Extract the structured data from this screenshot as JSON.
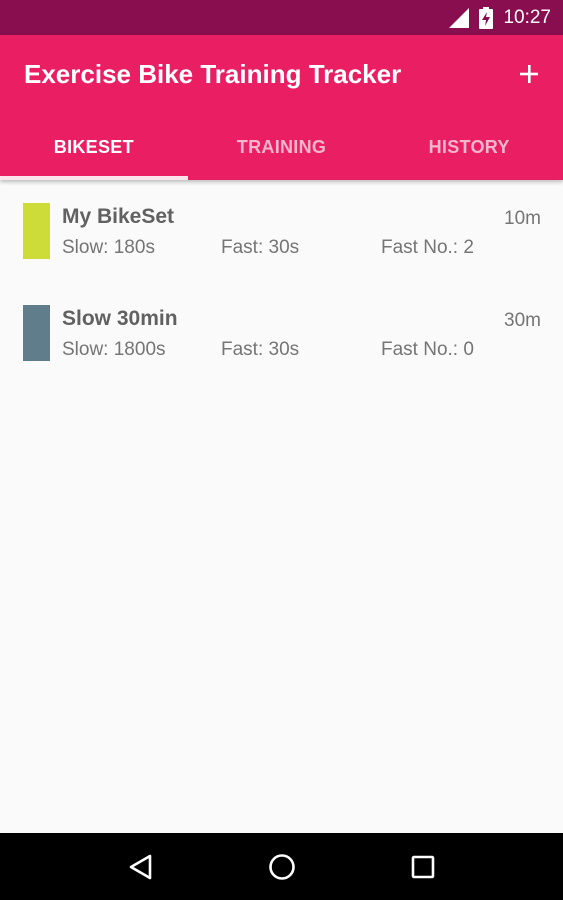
{
  "status_bar": {
    "time": "10:27",
    "icons": [
      "signal-icon",
      "battery-charging-icon"
    ]
  },
  "app_bar": {
    "title": "Exercise Bike Training Tracker",
    "action_icon": "plus-icon",
    "tabs": [
      {
        "label": "BIKESET",
        "active": true
      },
      {
        "label": "TRAINING",
        "active": false
      },
      {
        "label": "HISTORY",
        "active": false
      }
    ]
  },
  "bikesets": [
    {
      "name": "My BikeSet",
      "duration": "10m",
      "slow": "Slow: 180s",
      "fast": "Fast: 30s",
      "fast_no": "Fast No.: 2",
      "color": "#cddc39"
    },
    {
      "name": "Slow 30min",
      "duration": "30m",
      "slow": "Slow: 1800s",
      "fast": "Fast: 30s",
      "fast_no": "Fast No.: 0",
      "color": "#607d8b"
    }
  ],
  "nav_bar": {
    "icons": [
      "back-icon",
      "home-icon",
      "recents-icon"
    ]
  },
  "colors": {
    "primary": "#e91e63",
    "primary_dark": "#880e4f",
    "tab_indicator": "#fce4ec"
  }
}
